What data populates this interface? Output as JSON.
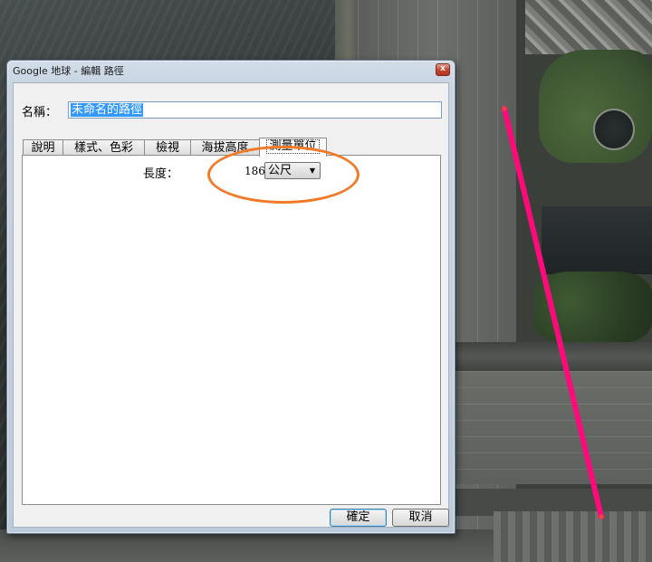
{
  "window": {
    "title": "Google 地球 - 編輯 路徑",
    "close_glyph": "x"
  },
  "form": {
    "name_label": "名稱：",
    "name_value": "未命名的路徑"
  },
  "tabs": [
    {
      "label": "說明",
      "active": false
    },
    {
      "label": "樣式、色彩",
      "active": false
    },
    {
      "label": "檢視",
      "active": false
    },
    {
      "label": "海拔高度",
      "active": false
    },
    {
      "label": "測量單位",
      "active": true
    }
  ],
  "measurement": {
    "length_label": "長度：",
    "length_value": "186",
    "unit_selected": "公尺",
    "dropdown_arrow": "▼"
  },
  "buttons": {
    "ok": "確定",
    "cancel": "取消"
  },
  "colors": {
    "path_line": "#ff0a7a",
    "highlight_ellipse": "#f07a28",
    "selection": "#3399ff"
  },
  "icons": {
    "close": "close-icon",
    "dropdown": "chevron-down-icon"
  }
}
